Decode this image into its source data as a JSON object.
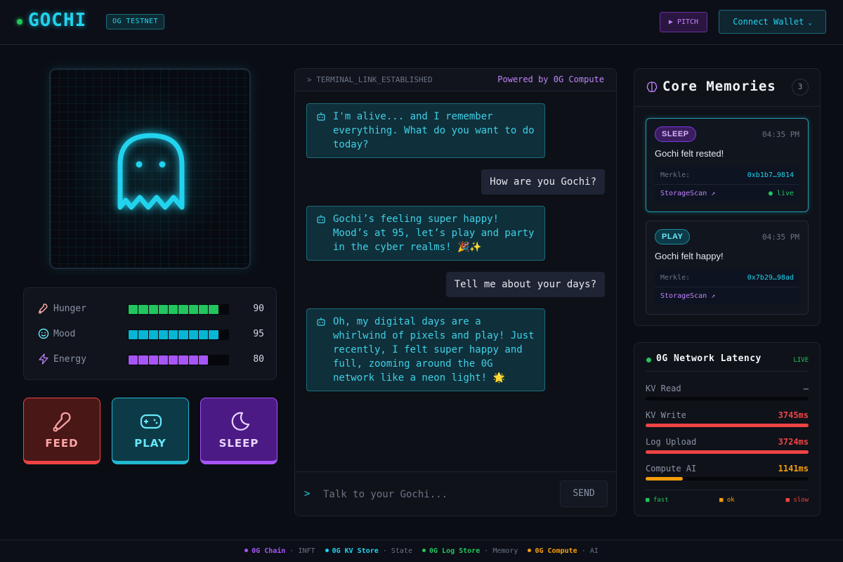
{
  "header": {
    "logo": "GOCHI",
    "network_badge": "OG TESTNET",
    "pitch_label": "▶ PITCH",
    "wallet_label": "Connect Wallet"
  },
  "pet": {
    "stats": [
      {
        "label": "Hunger",
        "value": 90,
        "color": "#22c55e",
        "icon": "meat-icon"
      },
      {
        "label": "Mood",
        "value": 95,
        "color": "#06b6d4",
        "icon": "smile-icon"
      },
      {
        "label": "Energy",
        "value": 80,
        "color": "#a855f7",
        "icon": "bolt-icon"
      }
    ],
    "actions": {
      "feed": "FEED",
      "play": "PLAY",
      "sleep": "SLEEP"
    }
  },
  "terminal": {
    "title": "> TERMINAL_LINK_ESTABLISHED",
    "powered": "Powered by 0G Compute",
    "messages": [
      {
        "role": "bot",
        "text": "I'm alive... and I remember everything. What do you want to do today?"
      },
      {
        "role": "user",
        "text": "How are you Gochi?"
      },
      {
        "role": "bot",
        "text": "Gochi’s feeling super happy! Mood’s at 95, let’s play and party in the cyber realms! 🎉✨"
      },
      {
        "role": "user",
        "text": "Tell me about your days?"
      },
      {
        "role": "bot",
        "text": "Oh, my digital days are a whirlwind of pixels and play! Just recently, I felt super happy and full, zooming around the 0G network like a neon light! 🌟"
      }
    ],
    "prompt": ">",
    "input_placeholder": "Talk to your Gochi...",
    "input_value": "",
    "send_label": "SEND"
  },
  "memories": {
    "title": "Core Memories",
    "count": "3",
    "items": [
      {
        "tag": "SLEEP",
        "time": "04:35 PM",
        "text": "Gochi felt rested!",
        "merkle_label": "Merkle:",
        "merkle": "0xb1b7…9814",
        "link": "StorageScan ↗",
        "status": "live"
      },
      {
        "tag": "PLAY",
        "time": "04:35 PM",
        "text": "Gochi felt happy!",
        "merkle_label": "Merkle:",
        "merkle": "0x7b29…98ad",
        "link": "StorageScan ↗",
        "status": ""
      }
    ]
  },
  "latency": {
    "title": "0G Network Latency",
    "live": "LIVE",
    "rows": [
      {
        "name": "KV Read",
        "value": "—",
        "fraction": 0,
        "color": "#6b7385"
      },
      {
        "name": "KV Write",
        "value": "3745ms",
        "fraction": 1.0,
        "color": "#ef4444"
      },
      {
        "name": "Log Upload",
        "value": "3724ms",
        "fraction": 1.0,
        "color": "#ef4444"
      },
      {
        "name": "Compute AI",
        "value": "1141ms",
        "fraction": 0.23,
        "color": "#f59e0b"
      }
    ],
    "legend": [
      {
        "label": "■ fast",
        "color": "#22c55e"
      },
      {
        "label": "■ ok",
        "color": "#f59e0b"
      },
      {
        "label": "■ slow",
        "color": "#ef4444"
      }
    ]
  },
  "footer": [
    {
      "name": "0G Chain",
      "sub": "INFT",
      "color": "#a855f7"
    },
    {
      "name": "0G KV Store",
      "sub": "State",
      "color": "#22d3ee"
    },
    {
      "name": "0G Log Store",
      "sub": "Memory",
      "color": "#22c55e"
    },
    {
      "name": "0G Compute",
      "sub": "AI",
      "color": "#f59e0b"
    }
  ]
}
